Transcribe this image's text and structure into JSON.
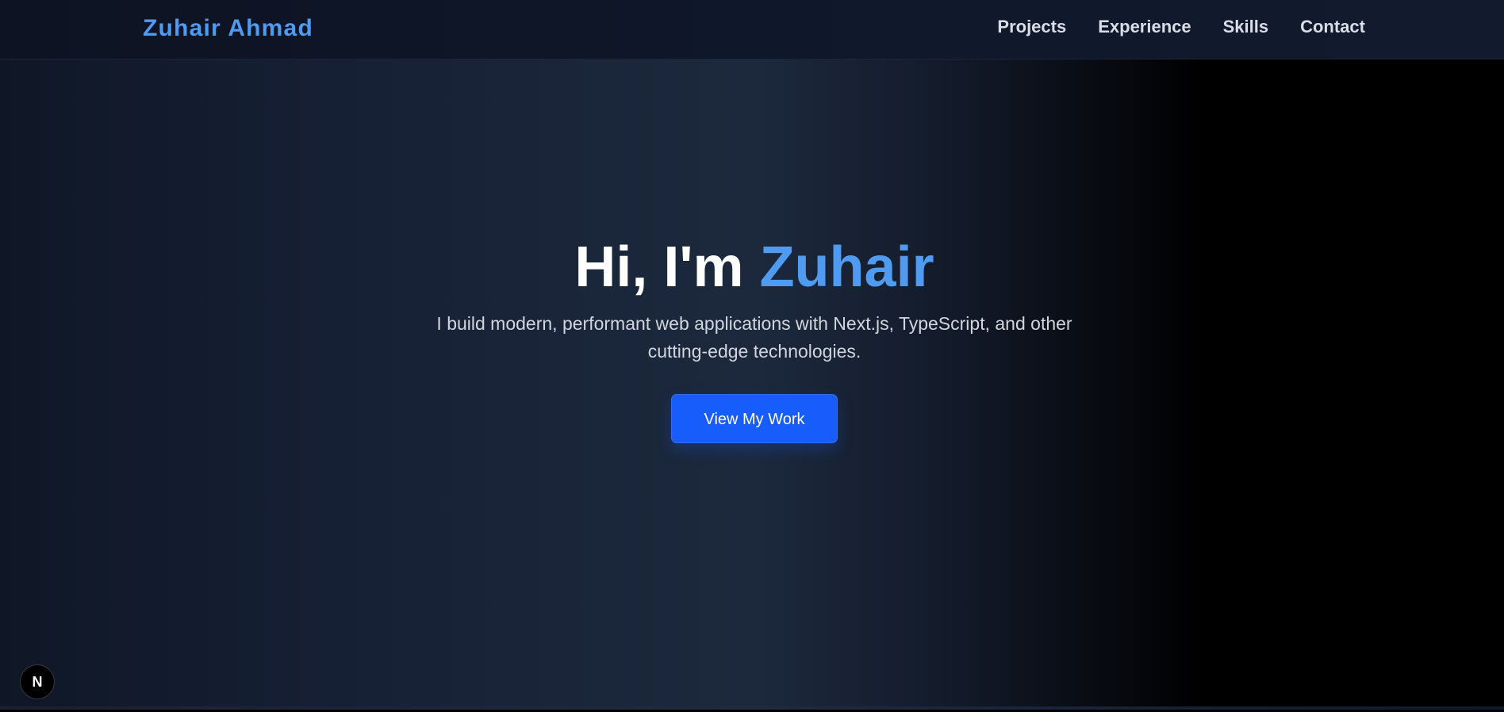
{
  "header": {
    "brand": "Zuhair Ahmad",
    "nav": [
      {
        "label": "Projects"
      },
      {
        "label": "Experience"
      },
      {
        "label": "Skills"
      },
      {
        "label": "Contact"
      }
    ]
  },
  "hero": {
    "greeting": "Hi, I'm",
    "name": "Zuhair",
    "subtitle": "I build modern, performant web applications with Next.js, TypeScript, and other cutting-edge technologies.",
    "cta_label": "View My Work"
  },
  "dev_badge": {
    "icon": "nextjs-logo-icon",
    "glyph": "N"
  },
  "colors": {
    "accent": "#4f9bf2",
    "cta": "#165dfb",
    "background": "#0f172a"
  }
}
